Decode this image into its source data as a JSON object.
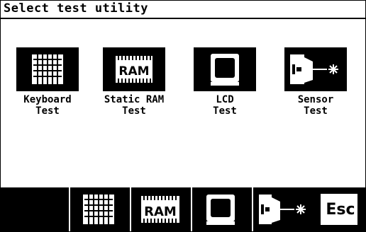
{
  "window": {
    "title": "Select test utility"
  },
  "utilities": [
    {
      "label": "Keyboard\nTest",
      "icon": "keyboard-icon"
    },
    {
      "label": "Static RAM\nTest",
      "icon": "ram-chip-icon"
    },
    {
      "label": "LCD\nTest",
      "icon": "monitor-icon"
    },
    {
      "label": "Sensor\nTest",
      "icon": "sensor-icon"
    }
  ],
  "toolbar": {
    "ram_text": "RAM",
    "esc_label": "Esc",
    "buttons": [
      "keyboard-icon",
      "ram-chip-icon",
      "monitor-icon",
      "sensor-icon",
      "esc"
    ]
  },
  "icons_ram_text": "RAM"
}
